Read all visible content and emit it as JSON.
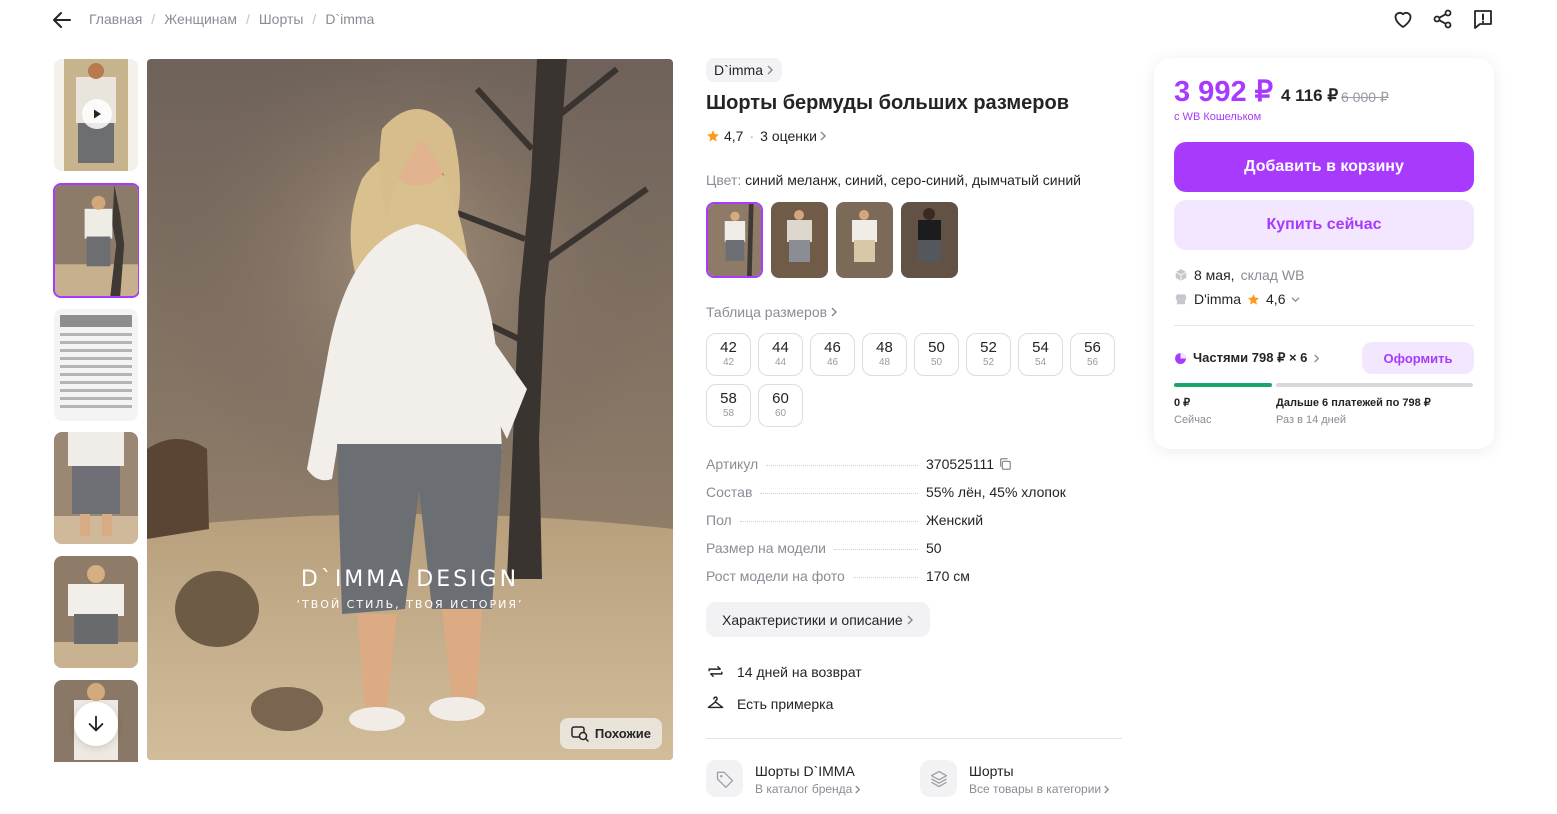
{
  "breadcrumb": [
    "Главная",
    "Женщинам",
    "Шорты",
    "D`imma"
  ],
  "main_image": {
    "title": "D`IMMA DESIGN",
    "subtitle": "‘ТВОЙ СТИЛЬ, ТВОЯ ИСТОРИЯ’",
    "similar_label": "Похожие"
  },
  "product": {
    "brand": "D`imma",
    "title": "Шорты бермуды больших размеров",
    "rating": "4,7",
    "reviews": "3 оценки",
    "color_label": "Цвет:",
    "color_value": "синий меланж, синий, серо-синий, дымчатый синий",
    "size_table_label": "Таблица размеров",
    "sizes": [
      {
        "ru": "42",
        "eu": "42"
      },
      {
        "ru": "44",
        "eu": "44"
      },
      {
        "ru": "46",
        "eu": "46"
      },
      {
        "ru": "48",
        "eu": "48"
      },
      {
        "ru": "50",
        "eu": "50"
      },
      {
        "ru": "52",
        "eu": "52"
      },
      {
        "ru": "54",
        "eu": "54"
      },
      {
        "ru": "56",
        "eu": "56"
      },
      {
        "ru": "58",
        "eu": "58"
      },
      {
        "ru": "60",
        "eu": "60"
      }
    ],
    "specs": [
      {
        "k": "Артикул",
        "v": "370525111"
      },
      {
        "k": "Состав",
        "v": "55% лён, 45% хлопок"
      },
      {
        "k": "Пол",
        "v": "Женский"
      },
      {
        "k": "Размер на модели",
        "v": "50"
      },
      {
        "k": "Рост модели на фото",
        "v": "170 см"
      }
    ],
    "desc_button": "Характеристики и описание",
    "features": [
      "14 дней на возврат",
      "Есть примерка"
    ],
    "links": [
      {
        "title": "Шорты D`IMMA",
        "sub": "В каталог бренда"
      },
      {
        "title": "Шорты",
        "sub": "Все товары в категории"
      }
    ]
  },
  "card": {
    "price": "3 992 ₽",
    "price_no_wallet": "4 116 ₽",
    "price_old": "6 000 ₽",
    "wallet_note": "с WB Кошельком",
    "add_to_cart": "Добавить в корзину",
    "buy_now": "Купить сейчас",
    "delivery_date": "8 мая,",
    "delivery_from": "склад WB",
    "seller": "D'imma",
    "seller_rating": "4,6",
    "installments": "Частями 798 ₽ × 6",
    "order_button": "Оформить",
    "plan_now_amount": "0 ₽",
    "plan_now_label": "Сейчас",
    "plan_next_amount": "Дальше 6 платежей по 798 ₽",
    "plan_next_label": "Раз в 14 дней"
  },
  "colors": {
    "accent": "#a73afd",
    "accent_light": "#f3e7ff",
    "progress_green": "#1aa56a"
  }
}
